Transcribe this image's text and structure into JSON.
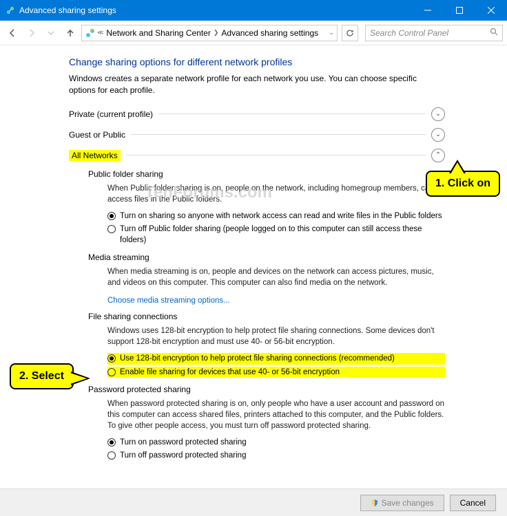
{
  "window": {
    "title": "Advanced sharing settings"
  },
  "nav": {
    "crumb1": "Network and Sharing Center",
    "crumb2": "Advanced sharing settings",
    "search_placeholder": "Search Control Panel"
  },
  "page": {
    "heading": "Change sharing options for different network profiles",
    "subtext": "Windows creates a separate network profile for each network you use. You can choose specific options for each profile."
  },
  "sections": {
    "private": "Private (current profile)",
    "guest": "Guest or Public",
    "all": "All Networks"
  },
  "public_folder": {
    "title": "Public folder sharing",
    "desc": "When Public folder sharing is on, people on the network, including homegroup members, can access files in the Public folders.",
    "opt1": "Turn on sharing so anyone with network access can read and write files in the Public folders",
    "opt2": "Turn off Public folder sharing (people logged on to this computer can still access these folders)"
  },
  "media": {
    "title": "Media streaming",
    "desc": "When media streaming is on, people and devices on the network can access pictures, music, and videos on this computer. This computer can also find media on the network.",
    "link": "Choose media streaming options..."
  },
  "filesharing": {
    "title": "File sharing connections",
    "desc": "Windows uses 128-bit encryption to help protect file sharing connections. Some devices don't support 128-bit encryption and must use 40- or 56-bit encryption.",
    "opt1": "Use 128-bit encryption to help protect file sharing connections (recommended)",
    "opt2": "Enable file sharing for devices that use 40- or 56-bit encryption"
  },
  "password": {
    "title": "Password protected sharing",
    "desc": "When password protected sharing is on, only people who have a user account and password on this computer can access shared files, printers attached to this computer, and the Public folders. To give other people access, you must turn off password protected sharing.",
    "opt1": "Turn on password protected sharing",
    "opt2": "Turn off password protected sharing"
  },
  "callouts": {
    "c1": "1. Click on",
    "c2": "2. Select"
  },
  "buttons": {
    "save": "Save changes",
    "cancel": "Cancel"
  },
  "watermark": "TenForums.com"
}
